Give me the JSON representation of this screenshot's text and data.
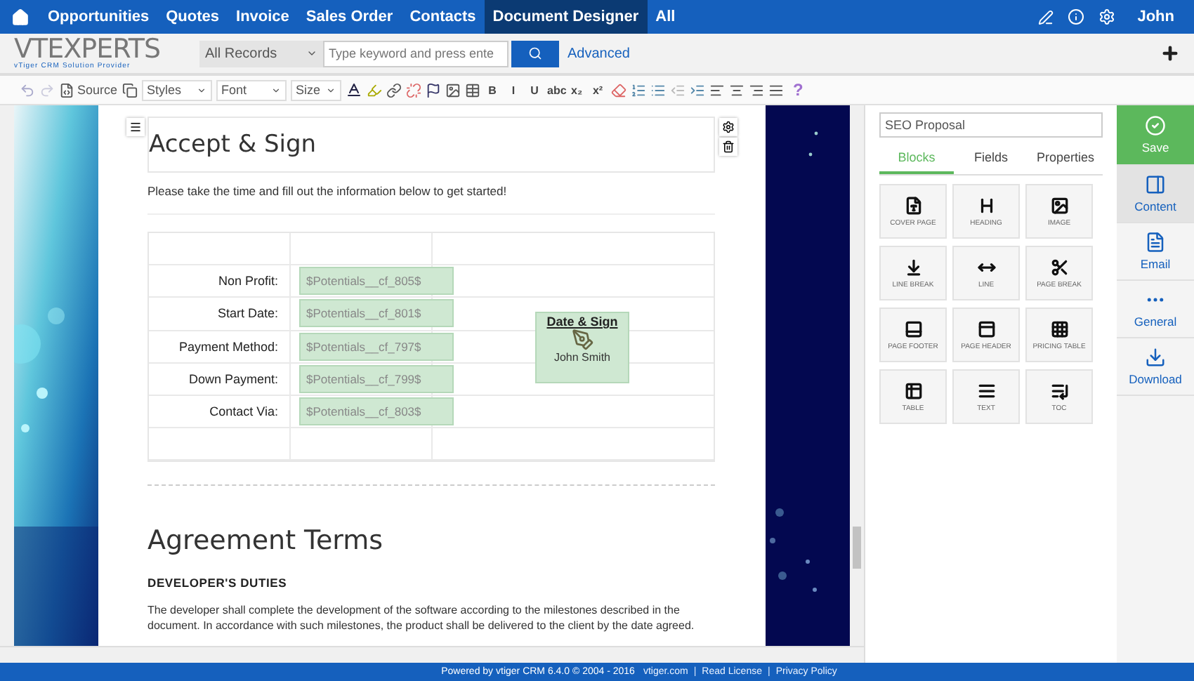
{
  "nav": {
    "items": [
      {
        "label": "Opportunities",
        "selected": false
      },
      {
        "label": "Quotes",
        "selected": false
      },
      {
        "label": "Invoice",
        "selected": false
      },
      {
        "label": "Sales Order",
        "selected": false
      },
      {
        "label": "Contacts",
        "selected": false
      },
      {
        "label": "Document Designer",
        "selected": true
      },
      {
        "label": "All",
        "selected": false
      }
    ],
    "user": "John"
  },
  "header": {
    "logo": "VTEXPERTS",
    "logo_tagline": "vTiger CRM Solution Provider",
    "record_filter": "All Records",
    "search_placeholder": "Type keyword and press ente",
    "advanced": "Advanced"
  },
  "toolbar": {
    "source": "Source",
    "dropdowns": [
      "Styles",
      "Font",
      "Size"
    ],
    "format_buttons": [
      "B",
      "I",
      "U",
      "abc",
      "x₂",
      "x²"
    ],
    "help": "?"
  },
  "document": {
    "heading": "Accept & Sign",
    "intro": "Please take the time and fill out the information below to get started!",
    "fields": [
      {
        "label": "Non Profit:",
        "value": "$Potentials__cf_805$"
      },
      {
        "label": "Start Date:",
        "value": "$Potentials__cf_801$"
      },
      {
        "label": "Payment Method:",
        "value": "$Potentials__cf_797$"
      },
      {
        "label": "Down Payment:",
        "value": "$Potentials__cf_799$"
      },
      {
        "label": "Contact Via:",
        "value": "$Potentials__cf_803$"
      }
    ],
    "signature": {
      "title": "Date & Sign",
      "name": "John Smith"
    },
    "section_heading": "Agreement Terms",
    "subheading": "DEVELOPER'S DUTIES",
    "paragraph": "The developer shall complete the development of the software according to the milestones described in the document. In accordance with such milestones, the product shall be delivered to the client by the date agreed."
  },
  "panel": {
    "title": "SEO Proposal",
    "tabs": [
      {
        "label": "Blocks",
        "selected": true
      },
      {
        "label": "Fields",
        "selected": false
      },
      {
        "label": "Properties",
        "selected": false
      }
    ],
    "blocks": [
      "COVER PAGE",
      "HEADING",
      "IMAGE",
      "LINE BREAK",
      "LINE",
      "PAGE BREAK",
      "PAGE FOOTER",
      "PAGE HEADER",
      "PRICING TABLE",
      "TABLE",
      "TEXT",
      "TOC"
    ]
  },
  "sidebar": [
    {
      "label": "Save",
      "kind": "save"
    },
    {
      "label": "Content",
      "kind": "tab",
      "selected": true
    },
    {
      "label": "Email",
      "kind": "tab",
      "selected": false
    },
    {
      "label": "General",
      "kind": "tab",
      "selected": false
    },
    {
      "label": "Download",
      "kind": "tab",
      "selected": false
    }
  ],
  "footer": [
    {
      "kind": "text",
      "text": "Powered by vtiger CRM 6.4.0  © 2004 - 2016"
    },
    {
      "kind": "link",
      "text": "vtiger.com"
    },
    {
      "kind": "separator",
      "text": "|"
    },
    {
      "kind": "link",
      "text": "Read License"
    },
    {
      "kind": "separator",
      "text": "|"
    },
    {
      "kind": "link",
      "text": "Privacy Policy"
    }
  ]
}
